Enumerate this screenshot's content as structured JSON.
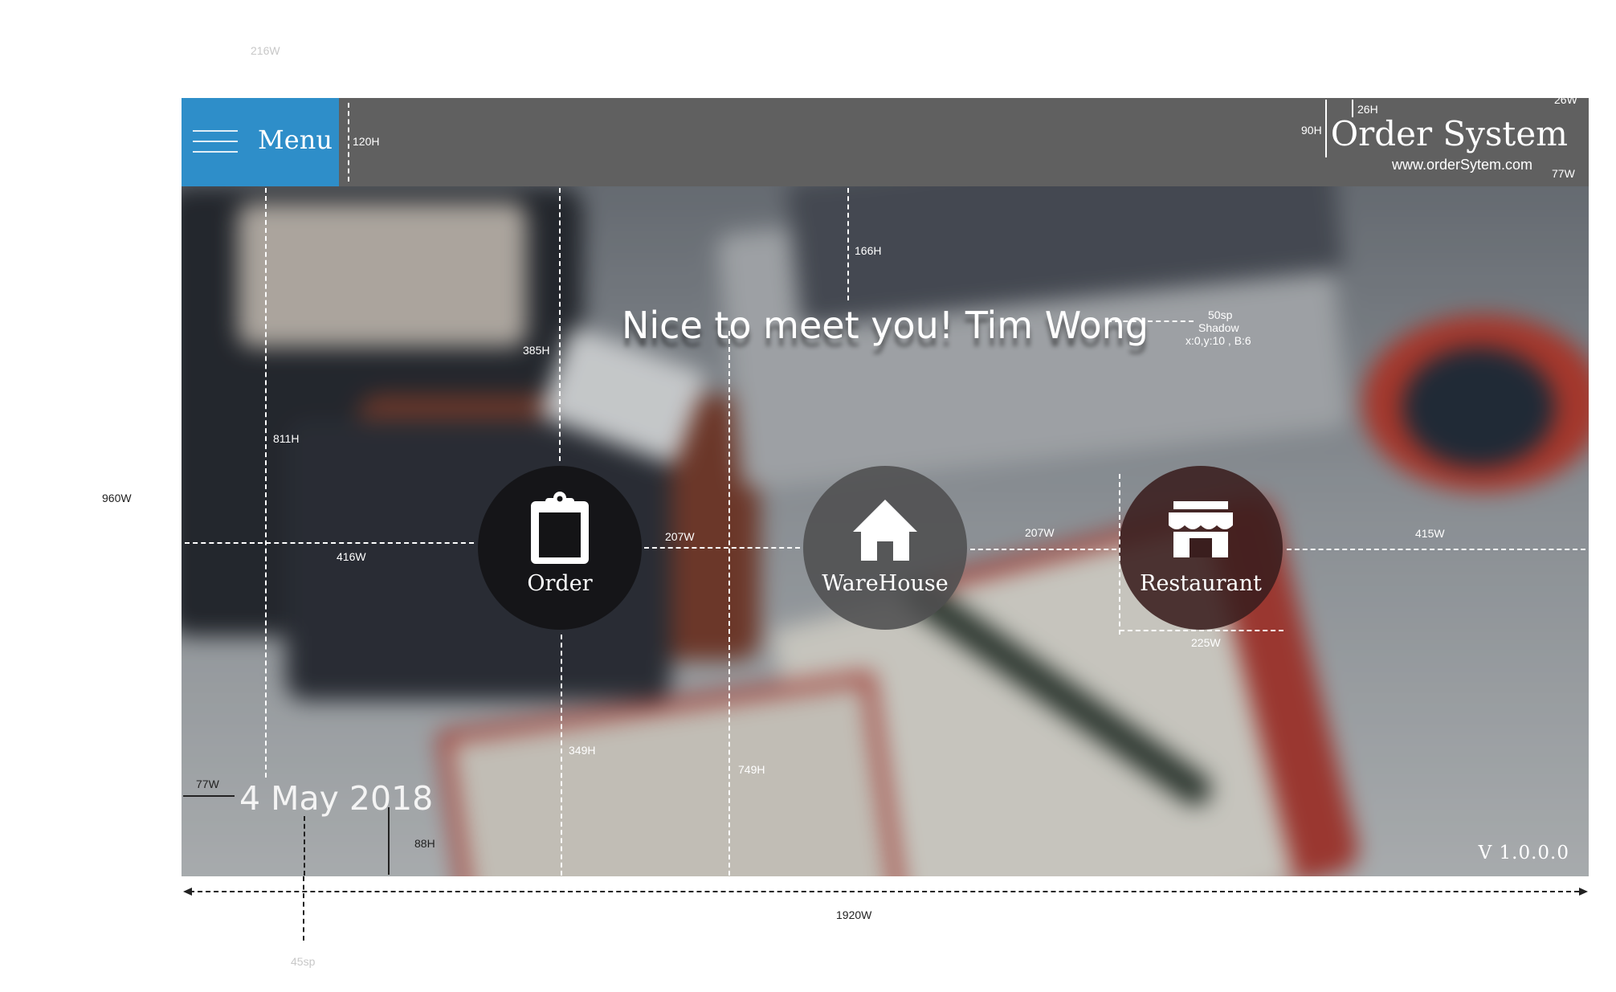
{
  "header": {
    "menu_label": "Menu",
    "title": "Order System",
    "website": "www.orderSytem.com"
  },
  "greeting": "Nice to meet you! Tim Wong",
  "nav": [
    {
      "label": "Order",
      "icon": "clipboard-icon",
      "tint": "#161616"
    },
    {
      "label": "WareHouse",
      "icon": "home-icon",
      "tint": "#555555"
    },
    {
      "label": "Restaurant",
      "icon": "store-icon",
      "tint": "#3a1e1e"
    }
  ],
  "date": "4 May 2018",
  "version": "V 1.0.0.0",
  "colors": {
    "menu_accent": "#2e8ec9",
    "topbar": "#606060"
  },
  "spec_annotations": {
    "top_faint": "216W",
    "canvas_height": "960W",
    "topbar_height": "120H",
    "title_height": "90H",
    "title_top": "26H",
    "title_right": "26W",
    "url_right": "77W",
    "greeting_top": "166H",
    "greeting_font": "50sp",
    "greeting_shadow": "Shadow",
    "greeting_shadow_values": "x:0,y:10 , B:6",
    "order_top": "385H",
    "date_top": "811H",
    "left_gap": "416W",
    "gap_1": "207W",
    "gap_2": "207W",
    "right_gap": "415W",
    "circle_width": "225W",
    "order_bottom": "349H",
    "greeting_bottom": "749H",
    "date_left": "77W",
    "date_bottom": "88H",
    "canvas_width": "1920W",
    "date_font": "45sp"
  }
}
